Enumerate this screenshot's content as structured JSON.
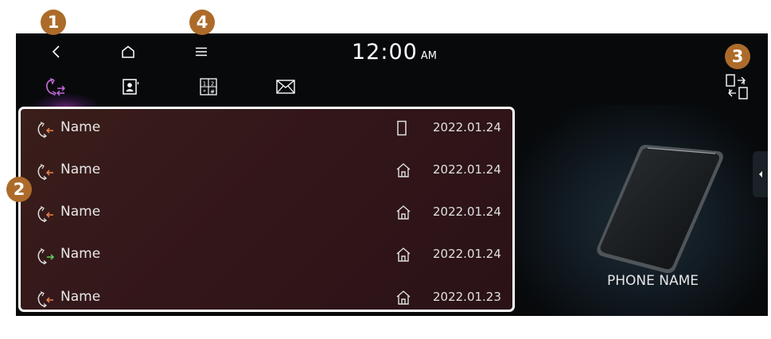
{
  "callouts": [
    "1",
    "2",
    "3",
    "4"
  ],
  "statusbar": {
    "time": "12:00",
    "ampm": "AM"
  },
  "tabs": [
    {
      "icon": "call-history-icon",
      "active": true
    },
    {
      "icon": "contacts-icon",
      "active": false
    },
    {
      "icon": "dial-pad-icon",
      "active": false
    },
    {
      "icon": "message-icon",
      "active": false
    }
  ],
  "call_log": [
    {
      "direction": "incoming",
      "name": "Name",
      "type_icon": "mobile-icon",
      "date": "2022.01.24"
    },
    {
      "direction": "incoming",
      "name": "Name",
      "type_icon": "home-icon",
      "date": "2022.01.24"
    },
    {
      "direction": "incoming",
      "name": "Name",
      "type_icon": "home-icon",
      "date": "2022.01.24"
    },
    {
      "direction": "outgoing",
      "name": "Name",
      "type_icon": "home-icon",
      "date": "2022.01.24"
    },
    {
      "direction": "incoming",
      "name": "Name",
      "type_icon": "home-icon",
      "date": "2022.01.23"
    }
  ],
  "device": {
    "name": "PHONE NAME"
  },
  "colors": {
    "callout": "#ad6b2a",
    "incoming_arrow": "#e8834a",
    "outgoing_arrow": "#5fd05f",
    "active_tab": "#c46adf"
  }
}
